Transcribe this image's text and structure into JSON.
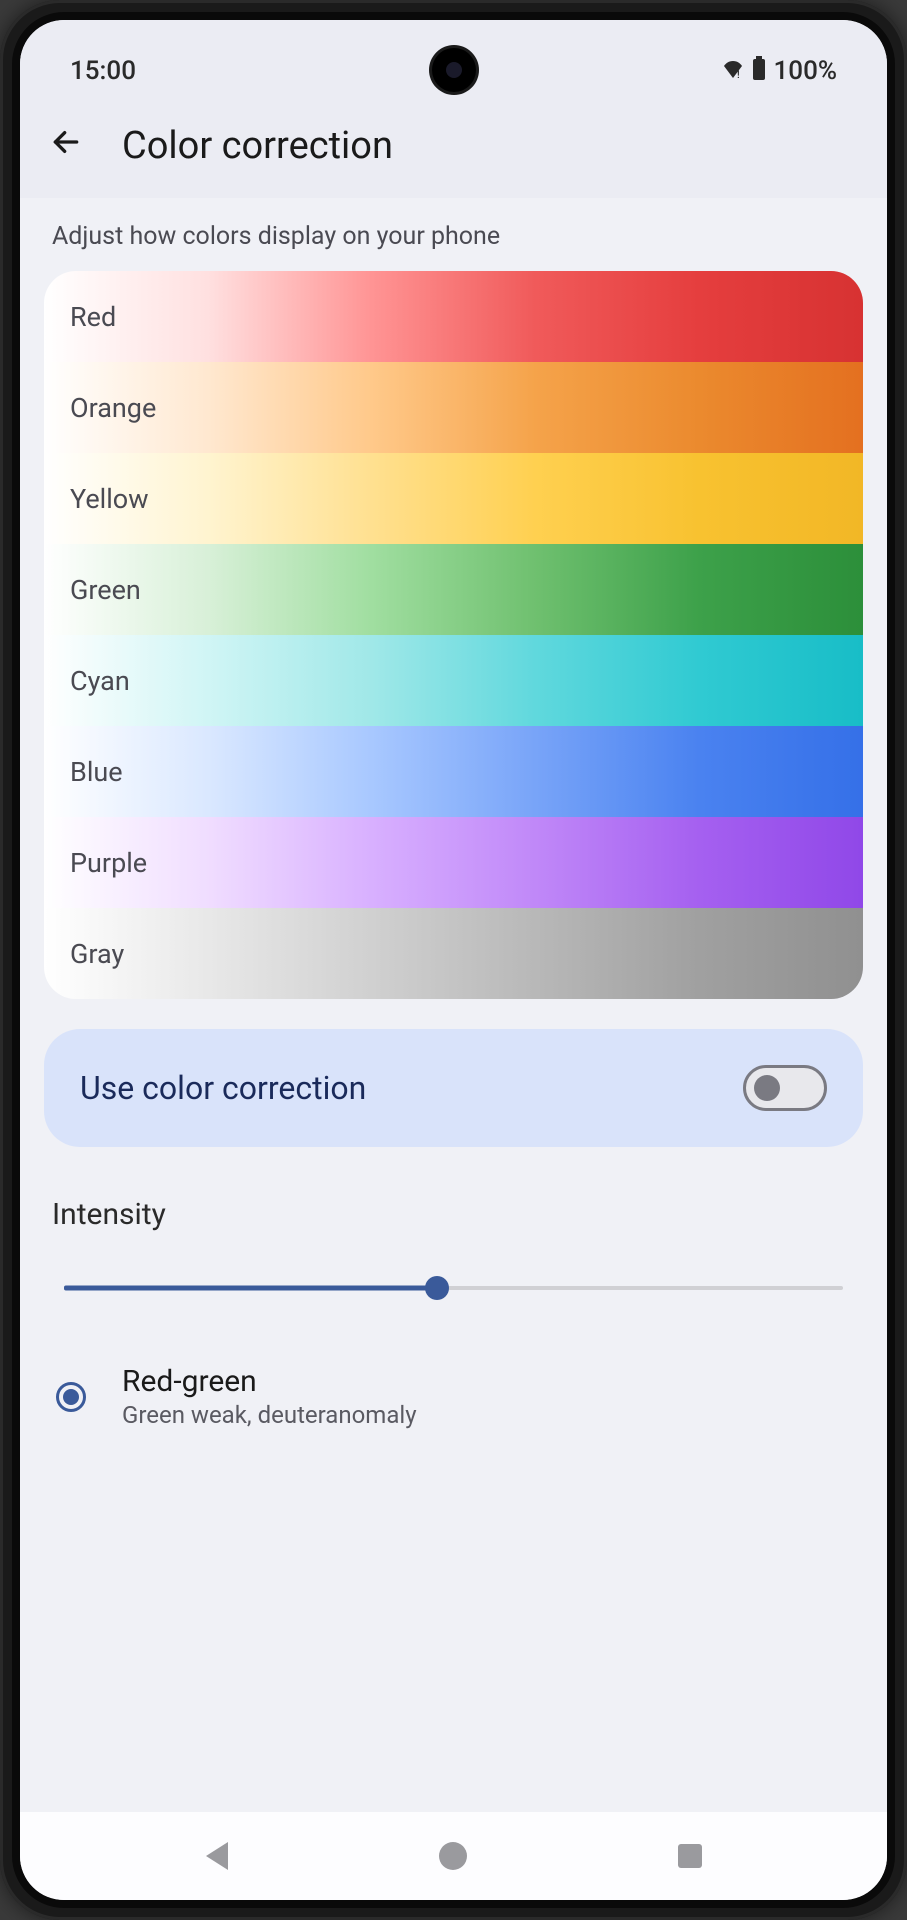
{
  "status": {
    "time": "15:00",
    "wifi_icon": "▾",
    "battery_icon": "▮",
    "battery_pct": "100%"
  },
  "header": {
    "title": "Color correction"
  },
  "subtitle": "Adjust how colors display on your phone",
  "colorRows": [
    "Red",
    "Orange",
    "Yellow",
    "Green",
    "Cyan",
    "Blue",
    "Purple",
    "Gray"
  ],
  "toggleCard": {
    "label": "Use color correction",
    "enabled": false
  },
  "intensity": {
    "label": "Intensity",
    "value_pct": 48
  },
  "selectedOption": {
    "title": "Red-green",
    "subtitle": "Green weak, deuteranomaly"
  }
}
